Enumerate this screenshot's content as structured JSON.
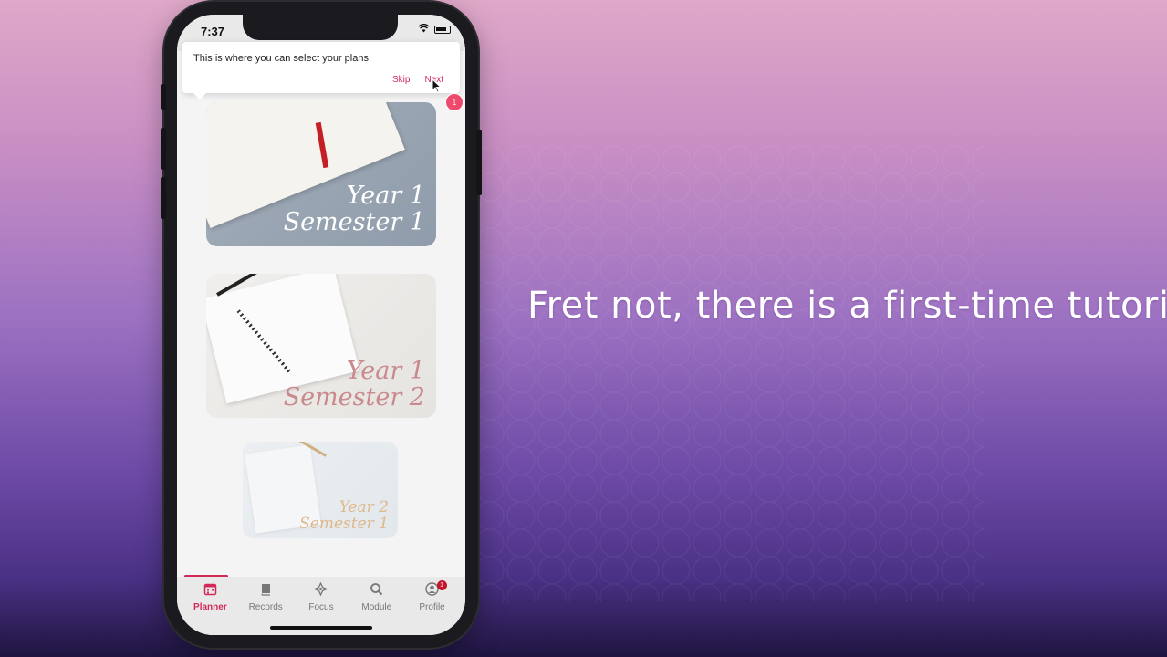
{
  "headline": "Fret not, there is a first-time tutorial",
  "status_bar": {
    "time": "7:37"
  },
  "tooltip": {
    "message": "This is where you can select your plans!",
    "skip_label": "Skip",
    "next_label": "Next",
    "step_badge": "1"
  },
  "plans": [
    {
      "line1": "Year 1",
      "line2": "Semester 1"
    },
    {
      "line1": "Year 1",
      "line2": "Semester 2"
    },
    {
      "line1": "Year 2",
      "line2": "Semester 1"
    }
  ],
  "tabs": [
    {
      "label": "Planner",
      "icon": "calendar-icon",
      "active": true
    },
    {
      "label": "Records",
      "icon": "book-icon",
      "active": false
    },
    {
      "label": "Focus",
      "icon": "focus-icon",
      "active": false
    },
    {
      "label": "Module",
      "icon": "search-icon",
      "active": false
    },
    {
      "label": "Profile",
      "icon": "profile-icon",
      "active": false,
      "badge": "1"
    }
  ],
  "colors": {
    "accent": "#d22a58",
    "badge": "#ef4a6c"
  }
}
